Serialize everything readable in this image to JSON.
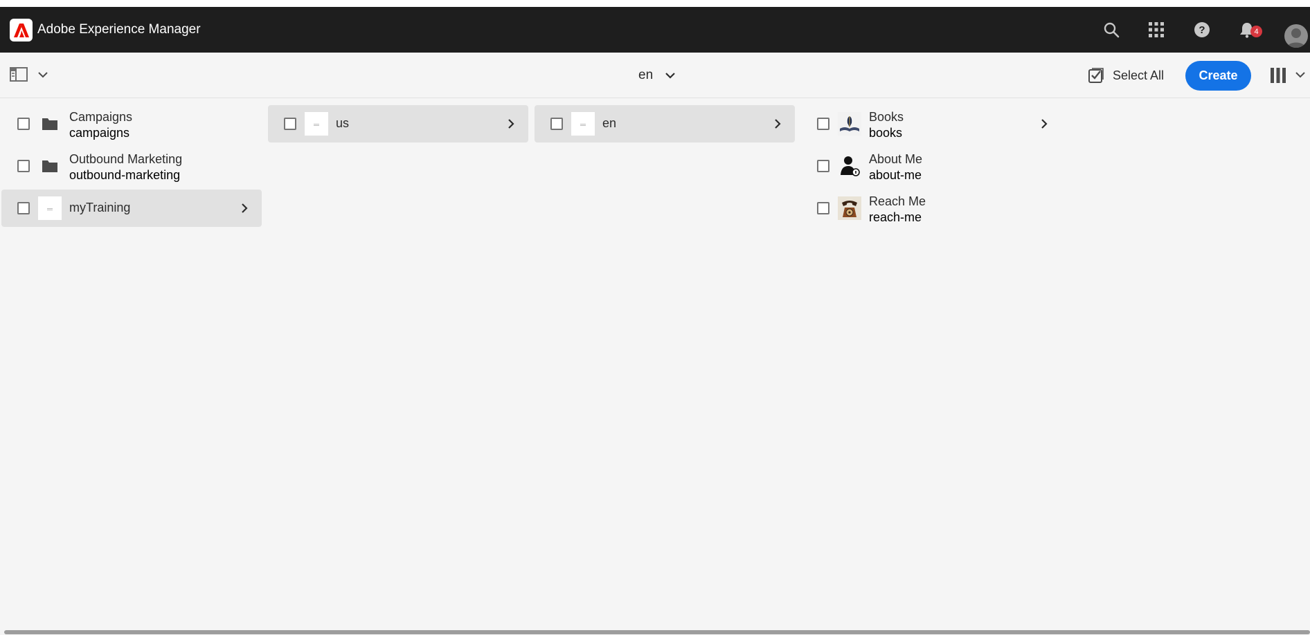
{
  "shell": {
    "brand": "Adobe Experience Manager",
    "notification_count": "4",
    "icons": [
      "search-icon",
      "apps-grid-icon",
      "help-icon",
      "bell-icon",
      "avatar"
    ]
  },
  "actionbar": {
    "current_title": "en",
    "select_all_label": "Select All",
    "create_label": "Create"
  },
  "columns": [
    {
      "items": [
        {
          "title": "Campaigns",
          "name": "campaigns",
          "thumb": "folder",
          "active": false,
          "has_children": false
        },
        {
          "title": "Outbound Marketing",
          "name": "outbound-marketing",
          "thumb": "folder",
          "active": false,
          "has_children": false
        },
        {
          "title": "myTraining",
          "name": "",
          "thumb": "page",
          "active": true,
          "has_children": true
        }
      ]
    },
    {
      "items": [
        {
          "title": "us",
          "name": "",
          "thumb": "page",
          "active": true,
          "has_children": true
        }
      ]
    },
    {
      "items": [
        {
          "title": "en",
          "name": "",
          "thumb": "page",
          "active": true,
          "has_children": true
        }
      ]
    },
    {
      "items": [
        {
          "title": "Books",
          "name": "books",
          "thumb": "books-image",
          "active": false,
          "has_children": true
        },
        {
          "title": "About Me",
          "name": "about-me",
          "thumb": "person-image",
          "active": false,
          "has_children": false
        },
        {
          "title": "Reach Me",
          "name": "reach-me",
          "thumb": "telephone-image",
          "active": false,
          "has_children": false
        }
      ]
    }
  ],
  "colors": {
    "shell_bg": "#1e1e1e",
    "accent": "#1473e6",
    "badge": "#d7373f",
    "adobe_red": "#eb1000"
  }
}
